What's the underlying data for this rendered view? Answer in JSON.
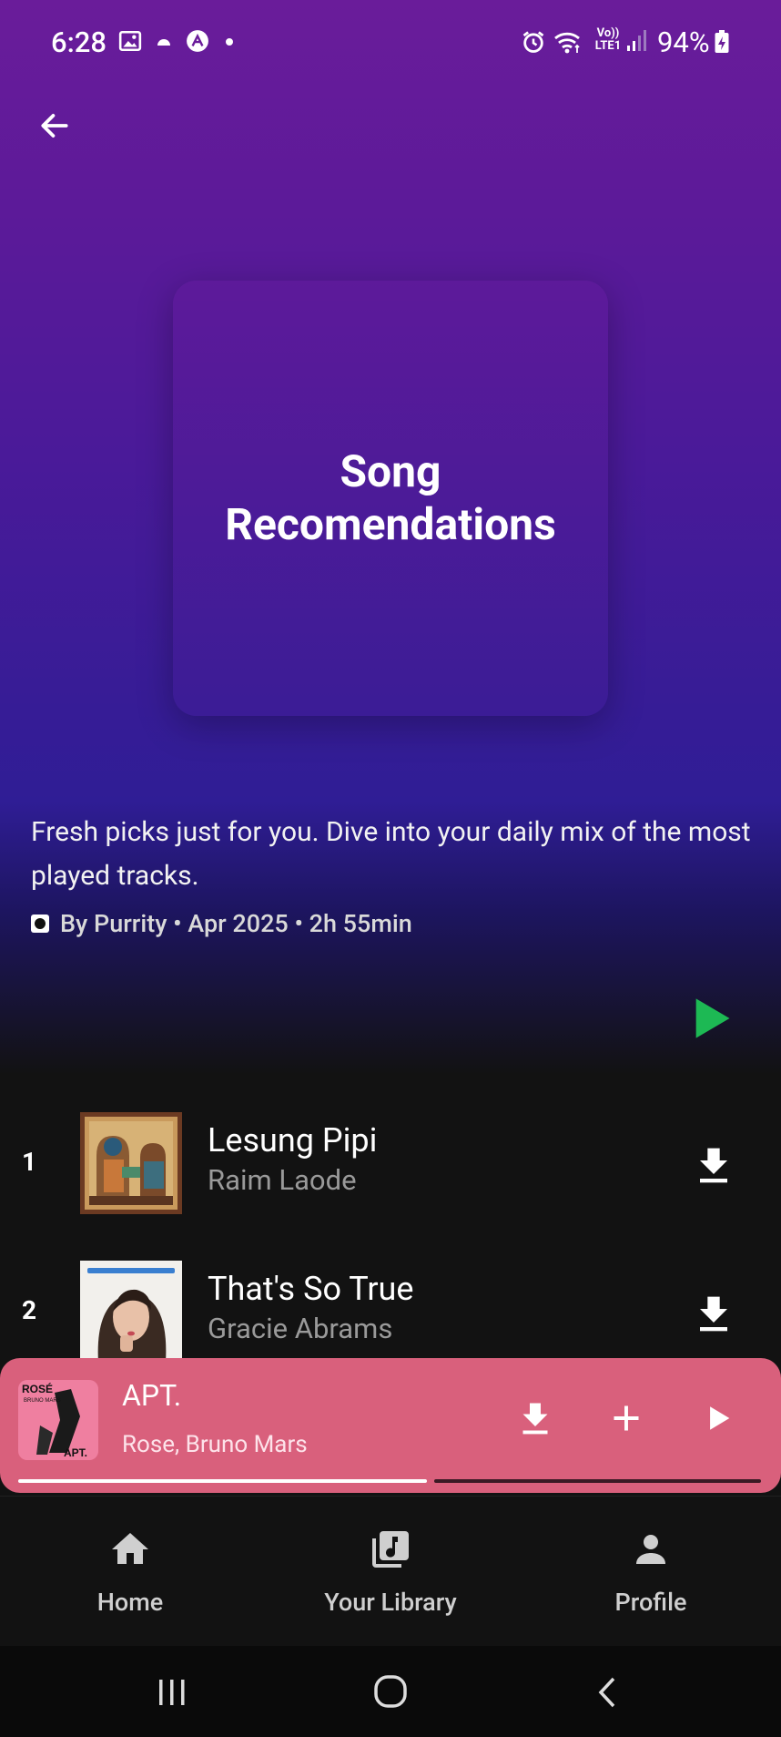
{
  "status_bar": {
    "time": "6:28",
    "network": "Vo)) LTE1",
    "battery": "94%"
  },
  "playlist": {
    "cover_title": "Song Recomendations",
    "description": "Fresh picks just for you. Dive into your daily mix of the most played tracks.",
    "meta": "By Purrity • Apr 2025 • 2h 55min"
  },
  "tracks": [
    {
      "number": "1",
      "title": "Lesung Pipi",
      "artist": "Raim Laode"
    },
    {
      "number": "2",
      "title": "That's So True",
      "artist": "Gracie Abrams"
    }
  ],
  "now_playing": {
    "title": "APT.",
    "artist": "Rose, Bruno Mars",
    "progress": 0.55,
    "album_art_text": [
      "ROSÉ",
      "BRUNO MARS",
      "APT."
    ]
  },
  "bottom_nav": [
    {
      "label": "Home",
      "icon": "home-icon"
    },
    {
      "label": "Your Library",
      "icon": "library-icon"
    },
    {
      "label": "Profile",
      "icon": "profile-icon"
    }
  ],
  "colors": {
    "accent_green": "#1db954",
    "mini_player": "#d9607c",
    "hero_top": "#6a1c9a",
    "hero_bottom": "#2f1d95"
  }
}
